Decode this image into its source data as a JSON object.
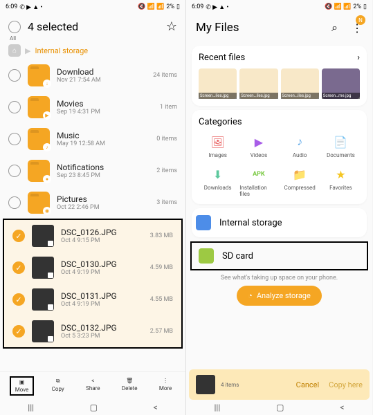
{
  "left": {
    "status": {
      "time": "6:09",
      "battery": "2%"
    },
    "header": {
      "title": "4 selected",
      "all": "All"
    },
    "breadcrumb": {
      "text": "Internal storage"
    },
    "folders": [
      {
        "name": "Download",
        "date": "Nov 21 7:54 AM",
        "meta": "24 items",
        "badge": "↓"
      },
      {
        "name": "Movies",
        "date": "Sep 19 4:31 PM",
        "meta": "1 item",
        "badge": "▶"
      },
      {
        "name": "Music",
        "date": "May 19 12:58 AM",
        "meta": "0 items",
        "badge": "♪"
      },
      {
        "name": "Notifications",
        "date": "Sep 23 8:45 PM",
        "meta": "2 items",
        "badge": "●"
      },
      {
        "name": "Pictures",
        "date": "Oct 22 2:46 PM",
        "meta": "3 items",
        "badge": "◉"
      }
    ],
    "selected": [
      {
        "name": "DSC_0126.JPG",
        "date": "Oct 4 9:15 PM",
        "size": "3.83 MB"
      },
      {
        "name": "DSC_0130.JPG",
        "date": "Oct 4 9:19 PM",
        "size": "4.59 MB"
      },
      {
        "name": "DSC_0131.JPG",
        "date": "Oct 4 9:19 PM",
        "size": "4.55 MB"
      },
      {
        "name": "DSC_0132.JPG",
        "date": "Oct 5 3:23 PM",
        "size": "2.57 MB"
      }
    ],
    "bottom": {
      "move": "Move",
      "copy": "Copy",
      "share": "Share",
      "delete": "Delete",
      "more": "More"
    }
  },
  "right": {
    "status": {
      "time": "6:09",
      "battery": "2%"
    },
    "title": "My Files",
    "recent": {
      "title": "Recent files",
      "thumbs": [
        "Screen…iles.jpg",
        "Screen…iles.jpg",
        "Screen…iles.jpg",
        "Screen…me.jpg"
      ]
    },
    "categories": {
      "title": "Categories",
      "items": [
        {
          "icon": "🖼",
          "label": "Images",
          "color": "#e85d5d"
        },
        {
          "icon": "▶",
          "label": "Videos",
          "color": "#a85de8"
        },
        {
          "icon": "♪",
          "label": "Audio",
          "color": "#5da8e8"
        },
        {
          "icon": "📄",
          "label": "Documents",
          "color": "#f5a623"
        },
        {
          "icon": "⬇",
          "label": "Downloads",
          "color": "#5dc89d"
        },
        {
          "icon": "APK",
          "label": "Installation files",
          "color": "#7ac943"
        },
        {
          "icon": "📁",
          "label": "Compressed",
          "color": "#f5a623"
        },
        {
          "icon": "★",
          "label": "Favorites",
          "color": "#f5c623"
        }
      ]
    },
    "storage": {
      "internal": "Internal storage",
      "sd": "SD card"
    },
    "analyze": {
      "hint": "See what's taking up space on your phone.",
      "button": "Analyze storage"
    },
    "copybar": {
      "count": "4 items",
      "cancel": "Cancel",
      "copy": "Copy here"
    }
  }
}
